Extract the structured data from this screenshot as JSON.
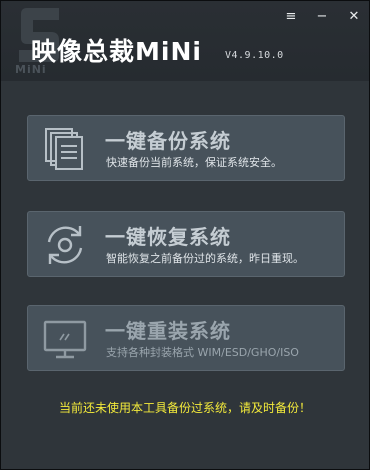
{
  "window": {
    "menu_icon": "≡",
    "minimize_icon": "−",
    "close_icon": "✕"
  },
  "header": {
    "title": "映像总裁MiNi",
    "version": "V4.9.10.0",
    "logo_text": "MiNi"
  },
  "actions": [
    {
      "title": "一键备份系统",
      "subtitle": "快速备份当前系统，保证系统安全。",
      "icon": "backup-pages-icon",
      "enabled": true
    },
    {
      "title": "一键恢复系统",
      "subtitle": "智能恢复之前备份过的系统，昨日重现。",
      "icon": "restore-arrows-icon",
      "enabled": true
    },
    {
      "title": "一键重装系统",
      "subtitle": "支持各种封装格式 WIM/ESD/GHO/ISO",
      "icon": "monitor-icon",
      "enabled": false
    }
  ],
  "status": {
    "message": "当前还未使用本工具备份过系统，请及时备份！"
  },
  "colors": {
    "accent_text": "#f3ea3b",
    "card_bg": "#47525b",
    "window_bg": "#2f353a"
  }
}
